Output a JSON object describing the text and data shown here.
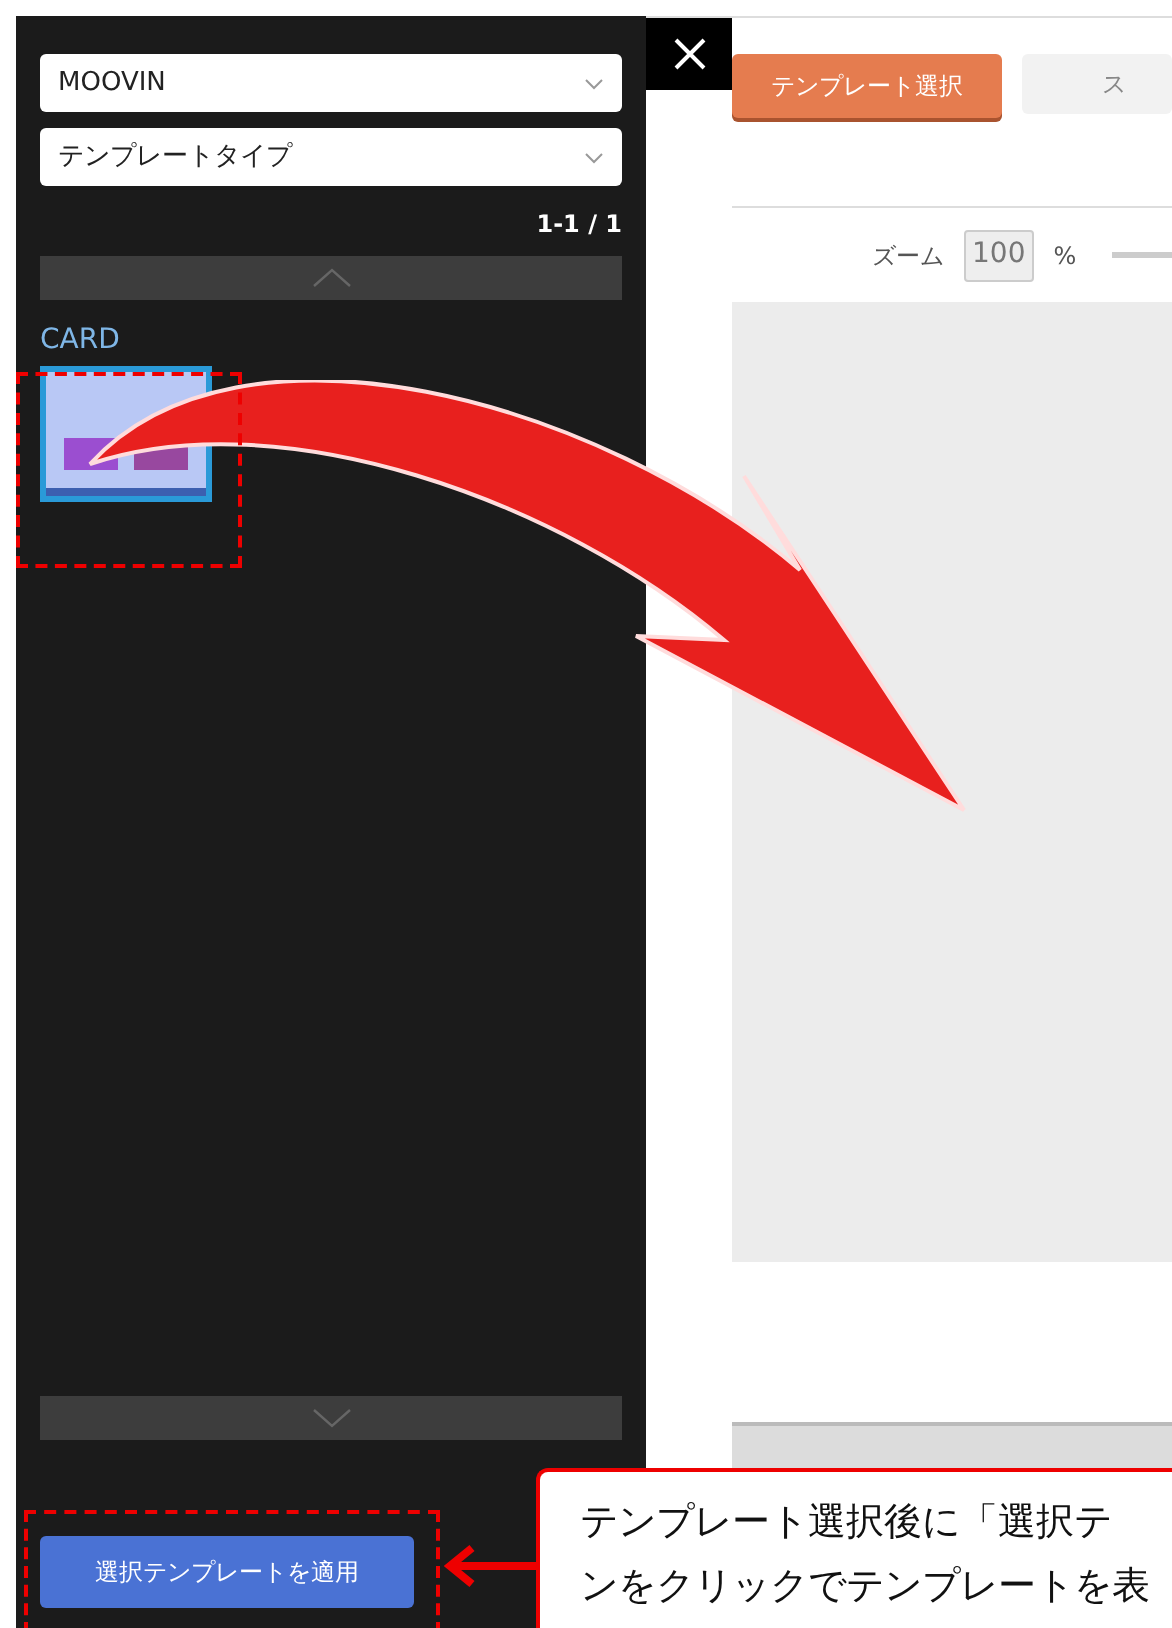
{
  "panel": {
    "selects": [
      {
        "value": "MOOVIN"
      },
      {
        "value": "テンプレートタイプ"
      }
    ],
    "page_count": "1-1 / 1",
    "category": "CARD",
    "templates": [
      {
        "selected": true
      }
    ],
    "apply_button": "選択テンプレートを適用"
  },
  "toolbar": {
    "buttons": [
      {
        "label": "テンプレート選択",
        "selected": true
      },
      {
        "label": "ス",
        "selected": false
      }
    ],
    "zoom_label": "ズーム",
    "zoom_value": "100",
    "zoom_unit": "%"
  },
  "annotation": {
    "lines": [
      "テンプレート選択後に「選択テ",
      "ンをクリックでテンプレートを表"
    ]
  }
}
